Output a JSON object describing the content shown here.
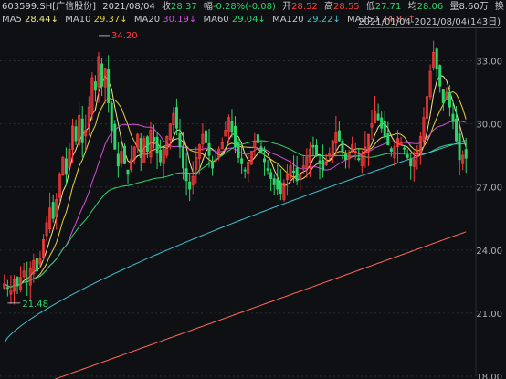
{
  "header": {
    "symbol": "603599.SH[广信股份]",
    "date": "2021/08/04",
    "close_label": "收",
    "close": "28.37",
    "change_label": "幅",
    "change": "-0.28%(-0.08)",
    "open_label": "开",
    "open": "28.52",
    "high_label": "高",
    "high": "28.55",
    "low_label": "低",
    "low": "27.71",
    "avg_label": "均",
    "avg": "28.06",
    "vol_label": "量",
    "vol": "8.60万",
    "turnover_label": "换"
  },
  "ma": [
    {
      "name": "MA5",
      "value": "28.44",
      "arrow": "↓",
      "color": "#f0e68c"
    },
    {
      "name": "MA10",
      "value": "29.37",
      "arrow": "↓",
      "color": "#e8d43a"
    },
    {
      "name": "MA20",
      "value": "30.19",
      "arrow": "↓",
      "color": "#d050d8"
    },
    {
      "name": "MA60",
      "value": "29.04",
      "arrow": "↓",
      "color": "#2fd46a"
    },
    {
      "name": "MA120",
      "value": "29.22",
      "arrow": "↓",
      "color": "#40c0d0"
    },
    {
      "name": "MA250",
      "value": "24.87",
      "arrow": "↑",
      "color": "#ff6a5a"
    }
  ],
  "range_label": "2021/01/04-2021/08/04(143日)",
  "colors": {
    "up": "#ff3b3b",
    "down": "#2fd46a",
    "bg": "#0f1014",
    "grid": "#2a2d33"
  },
  "chart_data": {
    "type": "candlestick",
    "ylim": [
      18.0,
      34.5
    ],
    "yticks": [
      "33.00",
      "30.00",
      "27.00",
      "24.00",
      "21.00",
      "18.00"
    ],
    "annotations": {
      "max": "34.20",
      "min": "21.48"
    },
    "close_series": [
      22.4,
      22.2,
      22.1,
      22.6,
      22.3,
      22.7,
      23.0,
      22.6,
      23.1,
      23.5,
      23.0,
      23.6,
      24.5,
      25.3,
      26.0,
      25.5,
      26.4,
      27.6,
      28.4,
      27.6,
      28.8,
      29.9,
      29.2,
      30.4,
      29.1,
      29.7,
      30.8,
      32.2,
      31.6,
      33.2,
      31.8,
      32.6,
      31.0,
      29.7,
      28.8,
      28.0,
      28.7,
      28.1,
      27.6,
      28.3,
      28.9,
      29.5,
      28.4,
      29.3,
      28.7,
      29.7,
      29.2,
      28.6,
      28.2,
      28.8,
      29.4,
      30.0,
      30.5,
      29.8,
      28.9,
      27.9,
      27.3,
      26.9,
      27.5,
      28.4,
      29.0,
      29.5,
      29.1,
      28.5,
      27.9,
      28.3,
      28.8,
      29.1,
      29.7,
      30.3,
      29.6,
      28.9,
      28.4,
      28.1,
      27.8,
      28.2,
      28.7,
      29.2,
      29.1,
      28.6,
      28.2,
      27.8,
      27.4,
      27.1,
      26.9,
      26.7,
      27.2,
      27.6,
      28.0,
      27.7,
      27.3,
      27.6,
      28.0,
      28.4,
      28.8,
      28.9,
      28.5,
      28.1,
      27.8,
      28.2,
      28.6,
      29.2,
      29.6,
      29.2,
      28.7,
      28.3,
      28.6,
      29.0,
      28.7,
      28.3,
      28.5,
      28.9,
      29.5,
      30.0,
      30.6,
      30.2,
      29.8,
      29.4,
      29.0,
      28.7,
      28.9,
      29.3,
      29.1,
      28.8,
      28.4,
      28.0,
      28.3,
      28.7,
      29.4,
      30.3,
      31.3,
      32.5,
      33.4,
      32.6,
      31.8,
      31.0,
      31.5,
      30.8,
      30.1,
      29.2,
      28.3,
      28.5,
      28.37
    ]
  }
}
